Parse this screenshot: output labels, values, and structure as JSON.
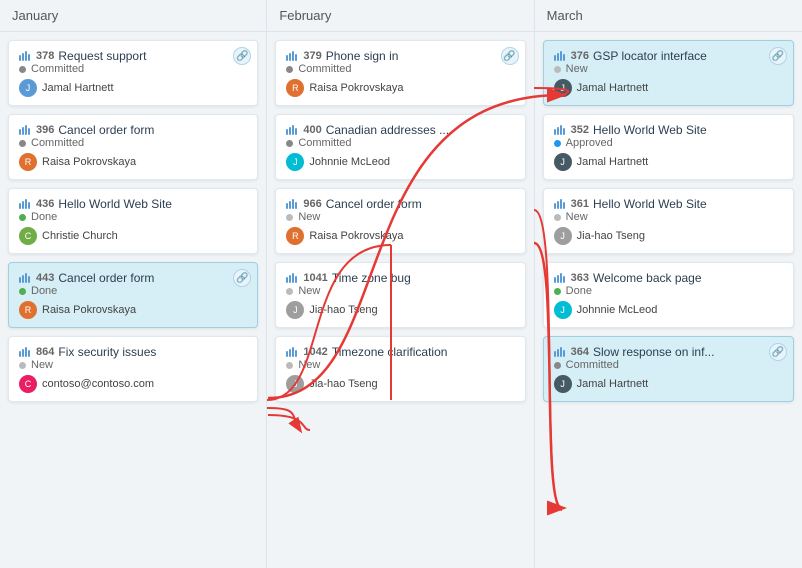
{
  "columns": [
    {
      "id": "january",
      "label": "January",
      "cards": [
        {
          "id": "378",
          "name": "Request support",
          "status": "Committed",
          "status_type": "committed",
          "user": "Jamal Hartnett",
          "avatar_class": "blue",
          "avatar_letter": "J",
          "highlighted": false,
          "has_link": true,
          "link_red": false
        },
        {
          "id": "396",
          "name": "Cancel order form",
          "status": "Committed",
          "status_type": "committed",
          "user": "Raisa Pokrovskaya",
          "avatar_class": "orange",
          "avatar_letter": "R",
          "highlighted": false,
          "has_link": false,
          "link_red": false
        },
        {
          "id": "436",
          "name": "Hello World Web Site",
          "status": "Done",
          "status_type": "done",
          "user": "Christie Church",
          "avatar_class": "green",
          "avatar_letter": "C",
          "highlighted": false,
          "has_link": false,
          "link_red": false
        },
        {
          "id": "443",
          "name": "Cancel order form",
          "status": "Done",
          "status_type": "done",
          "user": "Raisa Pokrovskaya",
          "avatar_class": "orange",
          "avatar_letter": "R",
          "highlighted": true,
          "has_link": true,
          "link_red": false
        },
        {
          "id": "864",
          "name": "Fix security issues",
          "status": "New",
          "status_type": "new",
          "user": "contoso@contoso.com",
          "avatar_class": "pink",
          "avatar_letter": "C",
          "highlighted": false,
          "has_link": false,
          "link_red": false
        }
      ]
    },
    {
      "id": "february",
      "label": "February",
      "cards": [
        {
          "id": "379",
          "name": "Phone sign in",
          "status": "Committed",
          "status_type": "committed",
          "user": "Raisa Pokrovskaya",
          "avatar_class": "orange",
          "avatar_letter": "R",
          "highlighted": false,
          "has_link": true,
          "link_red": false
        },
        {
          "id": "400",
          "name": "Canadian addresses ...",
          "status": "Committed",
          "status_type": "committed",
          "user": "Johnnie McLeod",
          "avatar_class": "teal",
          "avatar_letter": "J",
          "highlighted": false,
          "has_link": false,
          "link_red": true
        },
        {
          "id": "966",
          "name": "Cancel order form",
          "status": "New",
          "status_type": "new",
          "user": "Raisa Pokrovskaya",
          "avatar_class": "orange",
          "avatar_letter": "R",
          "highlighted": false,
          "has_link": false,
          "link_red": false
        },
        {
          "id": "1041",
          "name": "Time zone bug",
          "status": "New",
          "status_type": "new",
          "user": "Jia-hao Tseng",
          "avatar_class": "gray",
          "avatar_letter": "J",
          "highlighted": false,
          "has_link": false,
          "link_red": true
        },
        {
          "id": "1042",
          "name": "Timezone clarification",
          "status": "New",
          "status_type": "new",
          "user": "Jia-hao Tseng",
          "avatar_class": "gray",
          "avatar_letter": "J",
          "highlighted": false,
          "has_link": false,
          "link_red": false
        }
      ]
    },
    {
      "id": "march",
      "label": "March",
      "cards": [
        {
          "id": "376",
          "name": "GSP locator interface",
          "status": "New",
          "status_type": "new",
          "user": "Jamal Hartnett",
          "avatar_class": "dark",
          "avatar_letter": "J",
          "highlighted": true,
          "has_link": true,
          "link_red": false
        },
        {
          "id": "352",
          "name": "Hello World Web Site",
          "status": "Approved",
          "status_type": "approved",
          "user": "Jamal Hartnett",
          "avatar_class": "dark",
          "avatar_letter": "J",
          "highlighted": false,
          "has_link": false,
          "link_red": false
        },
        {
          "id": "361",
          "name": "Hello World Web Site",
          "status": "New",
          "status_type": "new",
          "user": "Jia-hao Tseng",
          "avatar_class": "gray",
          "avatar_letter": "J",
          "highlighted": false,
          "has_link": false,
          "link_red": false
        },
        {
          "id": "363",
          "name": "Welcome back page",
          "status": "Done",
          "status_type": "done",
          "user": "Johnnie McLeod",
          "avatar_class": "teal",
          "avatar_letter": "J",
          "highlighted": false,
          "has_link": false,
          "link_red": false
        },
        {
          "id": "364",
          "name": "Slow response on inf...",
          "status": "Committed",
          "status_type": "committed",
          "user": "Jamal Hartnett",
          "avatar_class": "dark",
          "avatar_letter": "J",
          "highlighted": true,
          "has_link": true,
          "link_red": false
        }
      ]
    }
  ]
}
